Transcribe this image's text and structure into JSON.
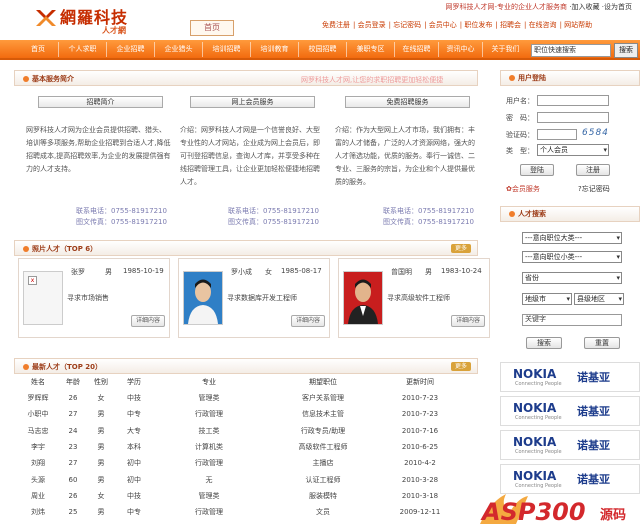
{
  "header": {
    "logo_text": "網羅科技",
    "logo_sub": "人才網",
    "box_link": "首页",
    "top_right": [
      "网罗科技人才网-专业的企业人才服务商",
      "·加入收藏",
      "·设为首页"
    ],
    "links": [
      "免费注册",
      "会员登录",
      "忘记密码",
      "会员中心",
      "职位发布",
      "招聘会",
      "在线咨询",
      "网站帮助"
    ]
  },
  "nav": {
    "items": [
      "首页",
      "个人求职",
      "企业招聘",
      "企业猎头",
      "培训招聘",
      "培训教育",
      "校园招聘",
      "兼职专区",
      "在线招聘",
      "资讯中心",
      "关于我们"
    ],
    "search_value": "职位快速搜索",
    "search_button": "搜索"
  },
  "intro": {
    "title": "基本服务简介",
    "tail": "网罗科技人才网,让您的求职招聘更加轻松便捷",
    "columns": [
      {
        "tab": "招聘简介",
        "text": "网罗科技人才网为企业会员提供招聘、猎头、培训等多项服务,帮助企业招聘到合适人才,降低招聘成本,提高招聘效率,为企业的发展提供强有力的人才支持。",
        "phone": "联系电话：0755-81917210",
        "fax": "图文传真：0755-81917210"
      },
      {
        "tab": "网上会员服务",
        "text": "介绍：网罗科技人才网是一个信誉良好、大型专业性的人才网站，企业成为网上会员后，即可刊登招聘信息，查询人才库，并享受多种在线招聘管理工具，让企业更加轻松便捷地招聘人才。",
        "phone": "联系电话：0755-81917210",
        "fax": "图文传真：0755-81917210"
      },
      {
        "tab": "免费招聘服务",
        "text": "介绍：作为大型网上人才市场，我们拥有：丰富的人才储备，广泛的人才资源网络，强大的人才筛选功能，优质的服务。奉行一诚信、二专业、三服务的宗旨，为企业和个人提供最优质的服务。",
        "phone": "联系电话：0755-81917210",
        "fax": "图文传真：0755-81917210"
      }
    ]
  },
  "photo_talent": {
    "title": "照片人才（TOP 6）",
    "more": "更多",
    "cards": [
      {
        "name": "张罗",
        "gender": "男",
        "birth": "1985-10-19",
        "position": "寻求市场销售",
        "button": "详细内容"
      },
      {
        "name": "罗小成",
        "gender": "女",
        "birth": "1985-08-17",
        "position": "寻求数据库开发工程师",
        "button": "详细内容"
      },
      {
        "name": "曾国明",
        "gender": "男",
        "birth": "1983-10-24",
        "position": "寻求高级软件工程师",
        "button": "详细内容"
      }
    ]
  },
  "latest_talent": {
    "title": "最新人才（TOP 20）",
    "more": "更多",
    "headers": [
      "姓名",
      "年龄",
      "性别",
      "学历",
      "专业",
      "期望职位",
      "更新时间"
    ],
    "rows": [
      [
        "罗辉辉",
        "26",
        "女",
        "中技",
        "管理类",
        "客户关系管理",
        "2010-7-23"
      ],
      [
        "小职中",
        "27",
        "男",
        "中专",
        "行政管理",
        "信息技术主管",
        "2010-7-23"
      ],
      [
        "马志忠",
        "24",
        "男",
        "大专",
        "技工类",
        "行政专员/助理",
        "2010-7-16"
      ],
      [
        "李宇",
        "23",
        "男",
        "本科",
        "计算机类",
        "高级软件工程师",
        "2010-6-25"
      ],
      [
        "刘翔",
        "27",
        "男",
        "初中",
        "行政管理",
        "主播店",
        "2010-4-2"
      ],
      [
        "头源",
        "60",
        "男",
        "初中",
        "无",
        "认证工程师",
        "2010-3-28"
      ],
      [
        "周业",
        "26",
        "女",
        "中技",
        "管理类",
        "服装模特",
        "2010-3-18"
      ],
      [
        "刘炜",
        "25",
        "男",
        "中专",
        "行政管理",
        "文员",
        "2009-12-11"
      ]
    ]
  },
  "login": {
    "title": "用户登陆",
    "username_label": "用户名：",
    "password_label": "密　码：",
    "captcha_label": "验证码：",
    "captcha_code": "6584",
    "type_label": "类　型：",
    "type_value": "个人会员",
    "login_button": "登陆",
    "register_button": "注册",
    "member_service": "会员服务",
    "forgot_password": "忘记密码"
  },
  "talent_search": {
    "title": "人才搜索",
    "select1": "---意向职位大类---",
    "select2": "---意向职位小类---",
    "province": "省份",
    "city": "地级市",
    "district": "县级地区",
    "keyword": "关键字",
    "search_button": "搜索",
    "reset_button": "重置"
  },
  "ads": [
    {
      "brand": "NOKIA",
      "tagline": "Connecting People",
      "cn": "诺基亚"
    },
    {
      "brand": "NOKIA",
      "tagline": "Connecting People",
      "cn": "诺基亚"
    },
    {
      "brand": "NOKIA",
      "tagline": "Connecting People",
      "cn": "诺基亚"
    },
    {
      "brand": "NOKIA",
      "tagline": "Connecting People",
      "cn": "诺基亚"
    }
  ],
  "watermark": {
    "text": "ASP300",
    "suffix": "源码"
  },
  "colors": {
    "brand": "#c62d00",
    "nav": "#f26b0f",
    "accent": "#f07d2b"
  }
}
